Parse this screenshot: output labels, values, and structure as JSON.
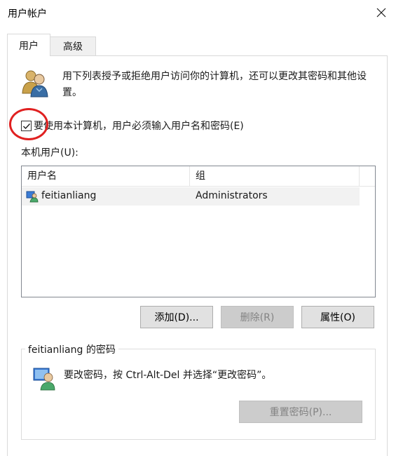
{
  "window": {
    "title": "用户帐户"
  },
  "tabs": [
    {
      "label": "用户",
      "active": true
    },
    {
      "label": "高级",
      "active": false
    }
  ],
  "description": "用下列表授予或拒绝用户访问你的计算机，还可以更改其密码和其他设置。",
  "require_login": {
    "label": "要使用本计算机，用户必须输入用户名和密码(E)",
    "checked": true,
    "annotation_color": "#e02020"
  },
  "users_list": {
    "label": "本机用户(U):",
    "columns": [
      "用户名",
      "组"
    ],
    "rows": [
      {
        "username": "feitianliang",
        "group": "Administrators",
        "icon": "user-account-icon"
      }
    ]
  },
  "buttons": {
    "add": "添加(D)...",
    "delete": "删除(R)",
    "properties": "属性(O)"
  },
  "password_group": {
    "title": "feitianliang 的密码",
    "instruction": "要改密码，按 Ctrl-Alt-Del 并选择“更改密码”。",
    "reset_button": "重置密码(P)..."
  }
}
